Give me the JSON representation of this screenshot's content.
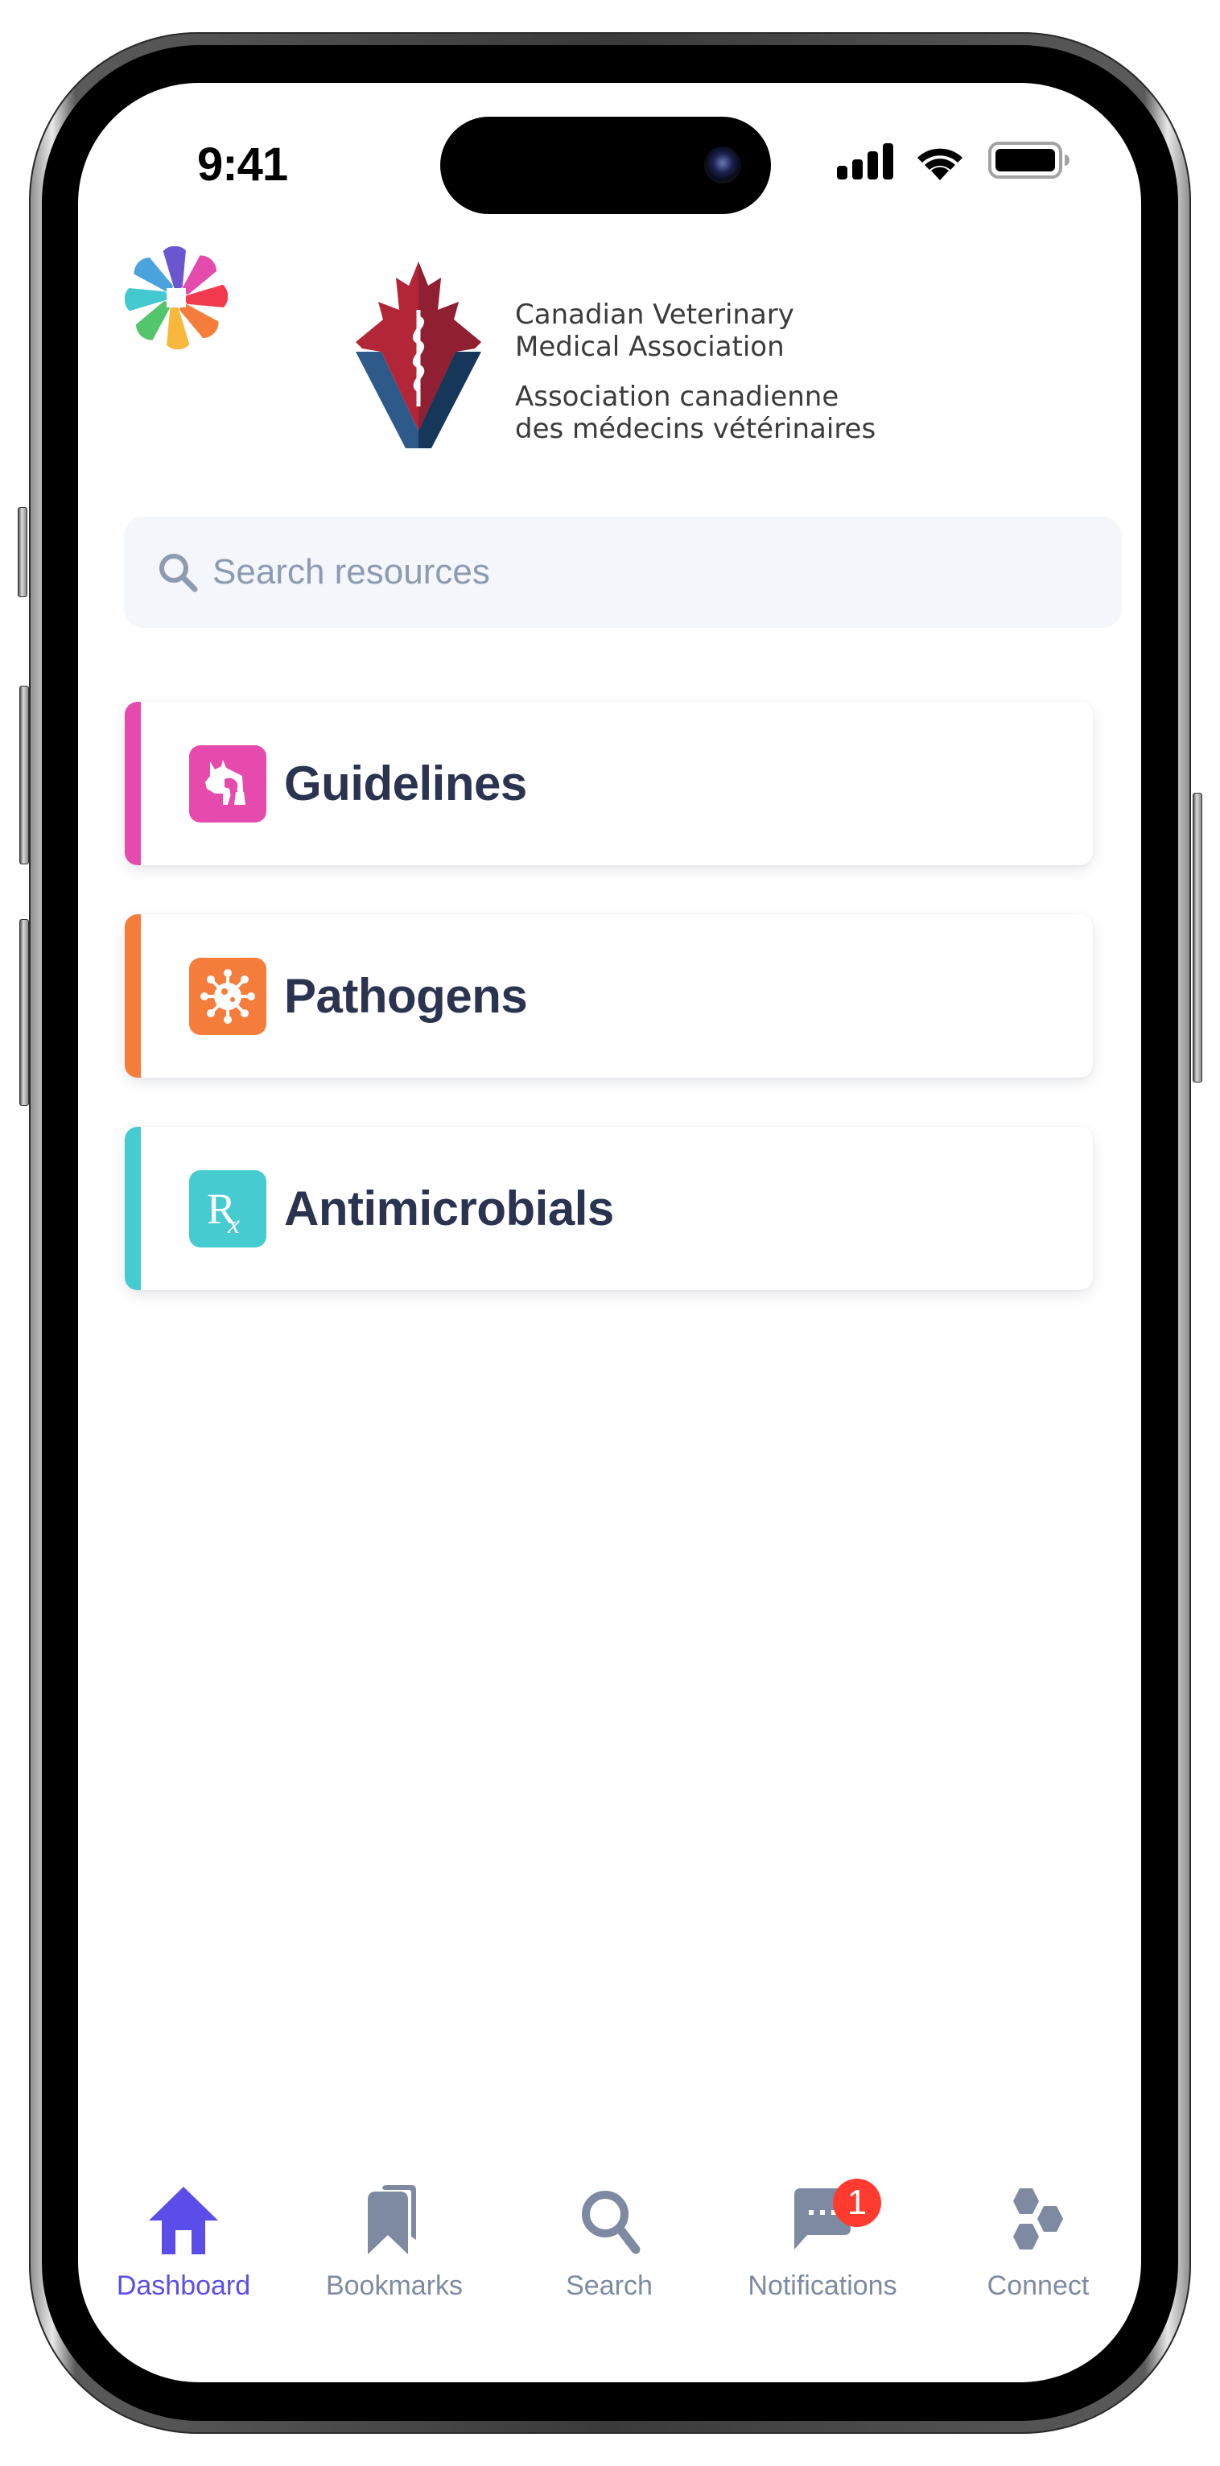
{
  "status_bar": {
    "time": "9:41"
  },
  "header": {
    "app_logo": "multicolor-petal-logo",
    "org_logo": {
      "line1": "Canadian Veterinary",
      "line2": "Medical Association",
      "line3": "Association canadienne",
      "line4": "des médecins vétérinaires"
    }
  },
  "search": {
    "placeholder": "Search resources",
    "value": "",
    "icon": "search-icon"
  },
  "cards": [
    {
      "label": "Guidelines",
      "icon": "animals-icon",
      "accent": "#e64aad"
    },
    {
      "label": "Pathogens",
      "icon": "virus-icon",
      "accent": "#f47d3b"
    },
    {
      "label": "Antimicrobials",
      "icon": "rx-icon",
      "accent": "#45cbd0"
    }
  ],
  "tabbar": {
    "active": "Dashboard",
    "active_color": "#5b4ee8",
    "inactive_color": "#7d8aa1",
    "items": [
      {
        "label": "Dashboard",
        "icon": "home-icon"
      },
      {
        "label": "Bookmarks",
        "icon": "bookmarks-icon"
      },
      {
        "label": "Search",
        "icon": "search-icon"
      },
      {
        "label": "Notifications",
        "icon": "chat-bubble-icon",
        "badge": "1"
      },
      {
        "label": "Connect",
        "icon": "hexagons-icon"
      }
    ]
  }
}
